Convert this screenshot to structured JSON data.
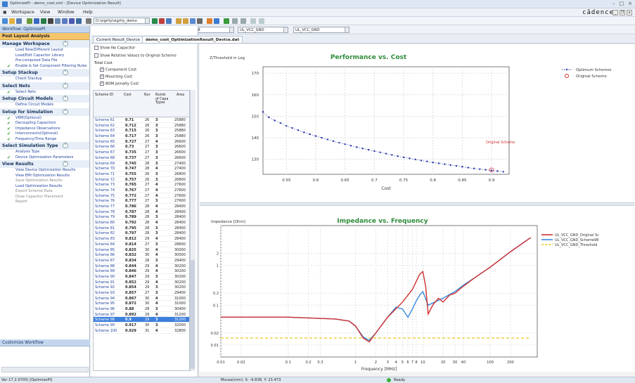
{
  "window": {
    "title": "OptimizePI - demo_cost.xml - [Device Optimization Result]",
    "controls": [
      "–",
      "□",
      "×"
    ]
  },
  "menu": {
    "items": [
      "Workspace",
      "View",
      "Window",
      "Help"
    ],
    "brand": "cādence"
  },
  "toolbar": {
    "path_value": "D:\\sigrity\\sigrity_demo",
    "mode_value": "Default",
    "net_a_value": "UL_VCC_GND",
    "net_b_value": "UL_VCC_GND"
  },
  "left_panel": {
    "header": "Workflow: OptimizePI",
    "title": "Post Layout Analysis",
    "sections": [
      {
        "title": "Manage Workspace",
        "items": [
          {
            "label": "Load New/Different Layout",
            "check": false,
            "gray": false
          },
          {
            "label": "Load/Edit Capacitor Library",
            "check": false,
            "gray": false
          },
          {
            "label": "Pre-computed Data File",
            "check": false,
            "gray": false
          },
          {
            "label": "Enable & Set Component Filtering Rules",
            "check": true,
            "gray": false
          }
        ]
      },
      {
        "title": "Setup Stackup",
        "items": [
          {
            "label": "Check Stackup",
            "check": false,
            "gray": false
          }
        ]
      },
      {
        "title": "Select Nets",
        "items": [
          {
            "label": "Select Nets",
            "check": true,
            "gray": false
          }
        ]
      },
      {
        "title": "Setup Circuit Models",
        "items": [
          {
            "label": "Define Circuit Models",
            "check": false,
            "gray": false
          }
        ]
      },
      {
        "title": "Setup for Simulation",
        "items": [
          {
            "label": "VRM(Optional)",
            "check": true,
            "gray": false
          },
          {
            "label": "Decoupling Capacitors",
            "check": true,
            "gray": false
          },
          {
            "label": "Impedance Observations",
            "check": true,
            "gray": false
          },
          {
            "label": "Interconnects(Optional)",
            "check": true,
            "gray": false
          },
          {
            "label": "Frequency/Time Range",
            "check": true,
            "gray": false
          }
        ]
      },
      {
        "title": "Select Simulation Type",
        "items": [
          {
            "label": "Analysis Type",
            "check": false,
            "gray": false
          },
          {
            "label": "Device Optimization Parameters",
            "check": true,
            "gray": false
          }
        ]
      },
      {
        "title": "View Results",
        "items": [
          {
            "label": "View Device Optimization Results",
            "check": false,
            "gray": false
          },
          {
            "label": "View EMI Optimization Results",
            "check": false,
            "gray": false
          },
          {
            "label": "Save Optimization Results",
            "check": false,
            "gray": true
          },
          {
            "label": "Load Optimization Results",
            "check": false,
            "gray": false
          },
          {
            "label": "Export Scheme Data",
            "check": false,
            "gray": true
          },
          {
            "label": "Draw Capacitor Placement",
            "check": false,
            "gray": true
          },
          {
            "label": "Report",
            "check": false,
            "gray": true
          }
        ]
      }
    ],
    "customize": "Customize Workflow"
  },
  "tabs": {
    "current_label": "Current Result_Device",
    "file_label": "demo_cost_OptimizationResult_Device.dat"
  },
  "options": {
    "show_no_cap": "Show No Capacitor",
    "show_relative": "Show Relative Values to Original Scheme",
    "total_cost": "Total Cost",
    "component_cost": "Component Cost",
    "mounting_cost": "Mounting Cost",
    "bom_penalty": "BOM penalty Cost"
  },
  "table": {
    "headers": {
      "id": "Scheme ID",
      "cost": "Cost",
      "nur": "Nur",
      "num": "Numb of Capa Types",
      "area": "Area"
    },
    "rows": [
      {
        "id": "Scheme 61",
        "cost": "0.71",
        "nur": "26",
        "num": "3",
        "area": "25880"
      },
      {
        "id": "Scheme 62",
        "cost": "0.712",
        "nur": "26",
        "num": "3",
        "area": "25880"
      },
      {
        "id": "Scheme 63",
        "cost": "0.715",
        "nur": "26",
        "num": "3",
        "area": "25880"
      },
      {
        "id": "Scheme 64",
        "cost": "0.717",
        "nur": "26",
        "num": "3",
        "area": "25880"
      },
      {
        "id": "Scheme 65",
        "cost": "0.727",
        "nur": "27",
        "num": "4",
        "area": "26600"
      },
      {
        "id": "Scheme 66",
        "cost": "0.73",
        "nur": "27",
        "num": "3",
        "area": "26600"
      },
      {
        "id": "Scheme 67",
        "cost": "0.735",
        "nur": "27",
        "num": "3",
        "area": "26600"
      },
      {
        "id": "Scheme 68",
        "cost": "0.737",
        "nur": "27",
        "num": "3",
        "area": "26600"
      },
      {
        "id": "Scheme 69",
        "cost": "0.745",
        "nur": "28",
        "num": "3",
        "area": "27400"
      },
      {
        "id": "Scheme 70",
        "cost": "0.747",
        "nur": "28",
        "num": "4",
        "area": "27400"
      },
      {
        "id": "Scheme 71",
        "cost": "0.755",
        "nur": "26",
        "num": "3",
        "area": "26800"
      },
      {
        "id": "Scheme 72",
        "cost": "0.757",
        "nur": "26",
        "num": "3",
        "area": "26800"
      },
      {
        "id": "Scheme 73",
        "cost": "0.765",
        "nur": "27",
        "num": "4",
        "area": "27600"
      },
      {
        "id": "Scheme 74",
        "cost": "0.767",
        "nur": "27",
        "num": "4",
        "area": "27600"
      },
      {
        "id": "Scheme 75",
        "cost": "0.772",
        "nur": "27",
        "num": "4",
        "area": "27600"
      },
      {
        "id": "Scheme 76",
        "cost": "0.777",
        "nur": "27",
        "num": "3",
        "area": "27600"
      },
      {
        "id": "Scheme 77",
        "cost": "0.786",
        "nur": "28",
        "num": "4",
        "area": "28400"
      },
      {
        "id": "Scheme 78",
        "cost": "0.787",
        "nur": "28",
        "num": "4",
        "area": "28400"
      },
      {
        "id": "Scheme 79",
        "cost": "0.789",
        "nur": "28",
        "num": "3",
        "area": "28400"
      },
      {
        "id": "Scheme 80",
        "cost": "0.792",
        "nur": "28",
        "num": "4",
        "area": "28400"
      },
      {
        "id": "Scheme 81",
        "cost": "0.795",
        "nur": "28",
        "num": "3",
        "area": "28400"
      },
      {
        "id": "Scheme 82",
        "cost": "0.797",
        "nur": "28",
        "num": "3",
        "area": "28400"
      },
      {
        "id": "Scheme 83",
        "cost": "0.812",
        "nur": "29",
        "num": "4",
        "area": "28400"
      },
      {
        "id": "Scheme 84",
        "cost": "0.814",
        "nur": "27",
        "num": "3",
        "area": "28600"
      },
      {
        "id": "Scheme 85",
        "cost": "0.825",
        "nur": "30",
        "num": "4",
        "area": "30000"
      },
      {
        "id": "Scheme 86",
        "cost": "0.832",
        "nur": "30",
        "num": "4",
        "area": "30000"
      },
      {
        "id": "Scheme 87",
        "cost": "0.834",
        "nur": "28",
        "num": "3",
        "area": "29400"
      },
      {
        "id": "Scheme 88",
        "cost": "0.844",
        "nur": "29",
        "num": "4",
        "area": "30200"
      },
      {
        "id": "Scheme 89",
        "cost": "0.846",
        "nur": "29",
        "num": "4",
        "area": "30200"
      },
      {
        "id": "Scheme 90",
        "cost": "0.847",
        "nur": "29",
        "num": "3",
        "area": "30200"
      },
      {
        "id": "Scheme 91",
        "cost": "0.852",
        "nur": "29",
        "num": "4",
        "area": "30200"
      },
      {
        "id": "Scheme 92",
        "cost": "0.854",
        "nur": "29",
        "num": "3",
        "area": "30200"
      },
      {
        "id": "Scheme 93",
        "cost": "0.857",
        "nur": "27",
        "num": "3",
        "area": "29400"
      },
      {
        "id": "Scheme 94",
        "cost": "0.867",
        "nur": "30",
        "num": "4",
        "area": "31000"
      },
      {
        "id": "Scheme 95",
        "cost": "0.872",
        "nur": "30",
        "num": "4",
        "area": "31000"
      },
      {
        "id": "Scheme 96",
        "cost": "0.88",
        "nur": "28",
        "num": "3",
        "area": "30400"
      },
      {
        "id": "Scheme 97",
        "cost": "0.892",
        "nur": "29",
        "num": "4",
        "area": "31200"
      },
      {
        "id": "Scheme 98",
        "cost": "0.9",
        "nur": "29",
        "num": "3",
        "area": "31200",
        "selected": true
      },
      {
        "id": "Scheme 99",
        "cost": "0.917",
        "nur": "30",
        "num": "3",
        "area": "32000"
      },
      {
        "id": "Scheme 100",
        "cost": "0.929",
        "nur": "31",
        "num": "4",
        "area": "32800"
      }
    ]
  },
  "colors": {
    "accent": "#3d7fdc",
    "original_red": "#d03030",
    "threshold": "#e6c619",
    "scheme_blue": "#3a8be0",
    "chart_title": "#2e8b3a"
  },
  "chart_data": [
    {
      "type": "scatter",
      "title": "Performance vs. Cost",
      "xlabel": "Cost",
      "ylabel": "Z/Threshold in Log",
      "xlim": [
        0.51,
        0.93
      ],
      "ylim": [
        123,
        173
      ],
      "xticks": [
        "0.55",
        "0.6",
        "0.65",
        "0.7",
        "0.75",
        "0.8",
        "0.85",
        "0.9"
      ],
      "yticks": [
        "130",
        "140",
        "150",
        "160",
        "170"
      ],
      "series": [
        {
          "name": "Optimum Schemes",
          "x": [
            0.51,
            0.52,
            0.53,
            0.54,
            0.55,
            0.56,
            0.57,
            0.58,
            0.59,
            0.6,
            0.61,
            0.62,
            0.63,
            0.64,
            0.65,
            0.66,
            0.67,
            0.68,
            0.69,
            0.7,
            0.71,
            0.72,
            0.73,
            0.74,
            0.75,
            0.76,
            0.77,
            0.78,
            0.79,
            0.8,
            0.81,
            0.82,
            0.83,
            0.84,
            0.85,
            0.86,
            0.87,
            0.88,
            0.89,
            0.9,
            0.91,
            0.92
          ],
          "y": [
            152,
            149.5,
            148,
            146.8,
            145.5,
            144.5,
            143.5,
            142.5,
            141.6,
            140.8,
            140,
            139.2,
            138.4,
            137.7,
            137,
            136.3,
            135.6,
            135,
            134.4,
            133.8,
            133.2,
            132.6,
            132,
            131.4,
            130.9,
            130.4,
            129.9,
            129.4,
            129,
            128.5,
            128.1,
            127.7,
            127.3,
            126.9,
            126.5,
            126.1,
            125.7,
            125.4,
            125.1,
            124.8,
            124.5,
            124.2
          ]
        },
        {
          "name": "Original Scheme",
          "x": [
            0.9
          ],
          "y": [
            125
          ]
        }
      ],
      "annotation": "Original Scheme",
      "legend": "top-right"
    },
    {
      "type": "line",
      "title": "Impedance vs. Frequency",
      "xlabel": "Frequency [MHz]",
      "ylabel": "Impedance [Ohm]",
      "xscale": "log",
      "yscale": "log",
      "xlim": [
        0.01,
        500
      ],
      "ylim": [
        0.005,
        10
      ],
      "xticks": [
        "0.01",
        "0.02",
        "0.1",
        "0.2",
        "0.3",
        "1",
        "2",
        "3",
        "4",
        "5",
        "6",
        "7",
        "8",
        "10",
        "20",
        "30",
        "40",
        "100",
        "200"
      ],
      "yticks": [
        "0.01",
        "0.02",
        "0.1",
        "0.2",
        "1",
        "2"
      ],
      "series": [
        {
          "name": "UL_VCC_GND_Original Sc",
          "color": "#d03030",
          "x": [
            0.01,
            0.1,
            0.5,
            0.8,
            1,
            1.3,
            1.6,
            2,
            3,
            5,
            7,
            8,
            9,
            10,
            11,
            12,
            14,
            17,
            20,
            25,
            30,
            40,
            60,
            100,
            200,
            400
          ],
          "y": [
            0.05,
            0.05,
            0.045,
            0.04,
            0.03,
            0.015,
            0.012,
            0.02,
            0.05,
            0.12,
            0.25,
            0.4,
            0.6,
            0.7,
            0.3,
            0.06,
            0.1,
            0.15,
            0.12,
            0.18,
            0.2,
            0.3,
            0.5,
            0.9,
            2.2,
            5
          ]
        },
        {
          "name": "UL_VCC_GND_Scheme98",
          "color": "#3a8be0",
          "x": [
            0.01,
            0.1,
            0.5,
            0.8,
            1,
            1.3,
            1.6,
            2,
            3,
            4,
            5,
            6,
            7,
            8,
            9,
            10,
            12,
            15,
            20,
            30,
            40,
            60,
            100,
            200,
            400
          ],
          "y": [
            0.05,
            0.05,
            0.045,
            0.04,
            0.03,
            0.016,
            0.013,
            0.02,
            0.05,
            0.09,
            0.08,
            0.05,
            0.08,
            0.13,
            0.18,
            0.22,
            0.1,
            0.12,
            0.15,
            0.22,
            0.32,
            0.5,
            0.9,
            2.2,
            5
          ]
        },
        {
          "name": "UL_VCC_GND_Threshold",
          "color": "#e6c619",
          "x": [
            0.01,
            400
          ],
          "y": [
            0.015,
            0.015
          ]
        }
      ],
      "legend": "top-right"
    }
  ],
  "status": {
    "version": "Ver 17.2.0705) [OptimizePI]",
    "mouse": "Mouse(mm): X: -6.838, Y: 23.473",
    "ready": "Ready"
  }
}
